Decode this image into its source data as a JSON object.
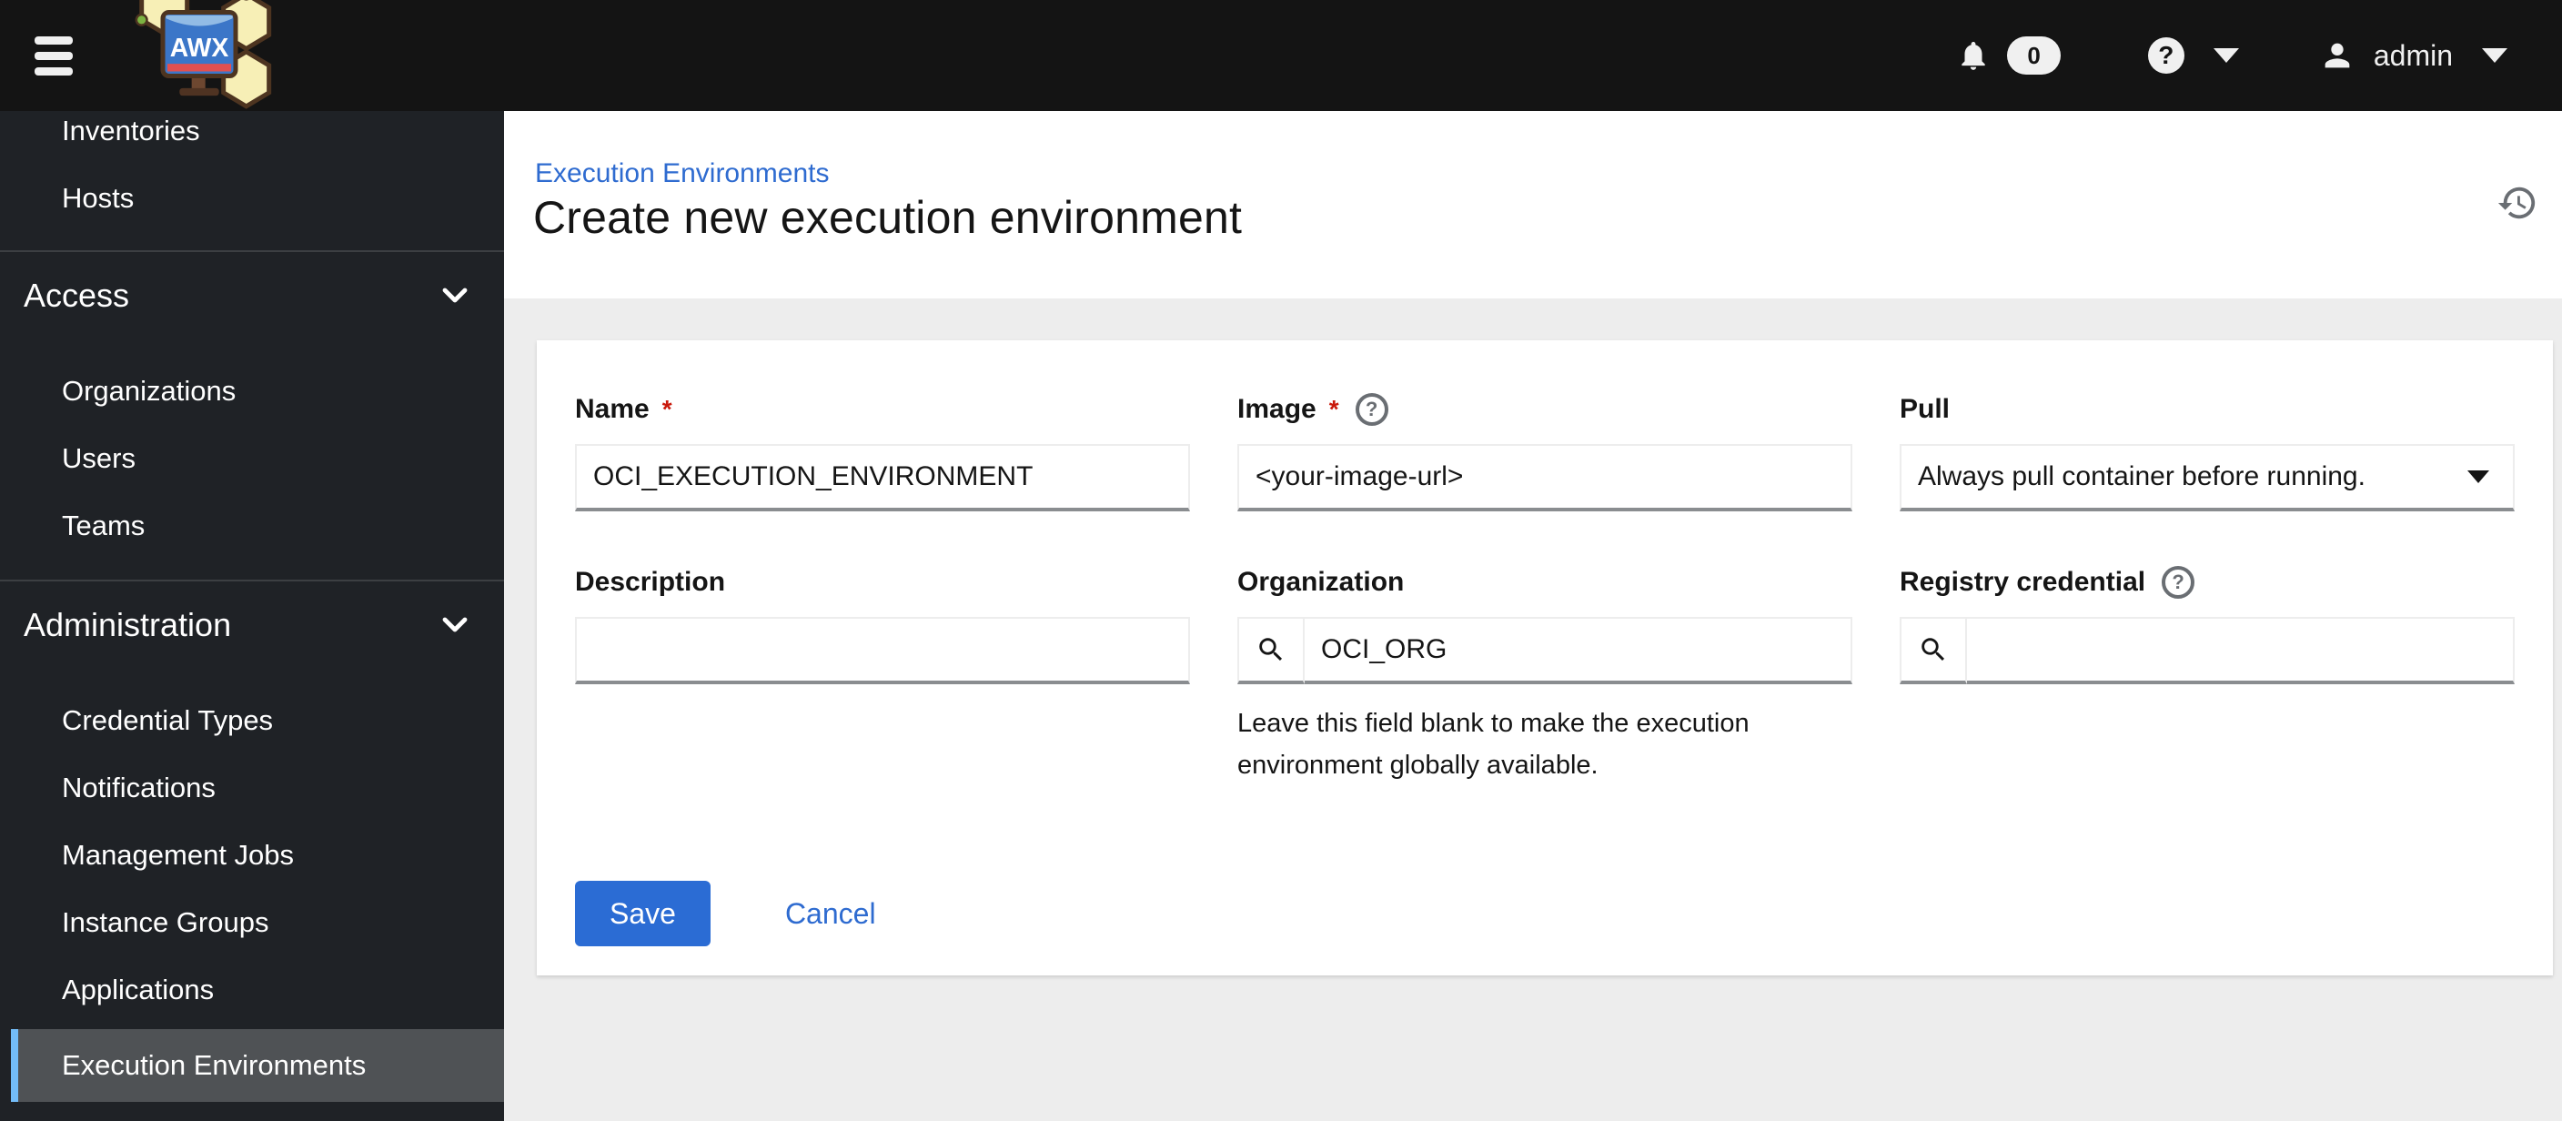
{
  "masthead": {
    "brand": "AWX",
    "notifications_count": "0",
    "user": "admin"
  },
  "icons": {
    "question_glyph": "?"
  },
  "sidebar": {
    "top_items": [
      "Inventories",
      "Hosts"
    ],
    "groups": [
      {
        "label": "Access",
        "items": [
          "Organizations",
          "Users",
          "Teams"
        ]
      },
      {
        "label": "Administration",
        "items": [
          "Credential Types",
          "Notifications",
          "Management Jobs",
          "Instance Groups",
          "Applications",
          "Execution Environments"
        ],
        "selected": "Execution Environments"
      }
    ]
  },
  "header": {
    "breadcrumb": "Execution Environments",
    "title": "Create new execution environment"
  },
  "form": {
    "required_marker": "*",
    "name": {
      "label": "Name",
      "value": "OCI_EXECUTION_ENVIRONMENT"
    },
    "image": {
      "label": "Image",
      "value": "<your-image-url>"
    },
    "pull": {
      "label": "Pull",
      "value": "Always pull container before running."
    },
    "description": {
      "label": "Description",
      "value": ""
    },
    "organization": {
      "label": "Organization",
      "value": "OCI_ORG",
      "helper": "Leave this field blank to make the execution environment globally available."
    },
    "registry_credential": {
      "label": "Registry credential",
      "value": ""
    },
    "actions": {
      "save": "Save",
      "cancel": "Cancel"
    }
  },
  "colors": {
    "accent_blue": "#2b6cd4",
    "sidebar_selected_accent": "#73bcf7",
    "required_red": "#c9190b"
  }
}
